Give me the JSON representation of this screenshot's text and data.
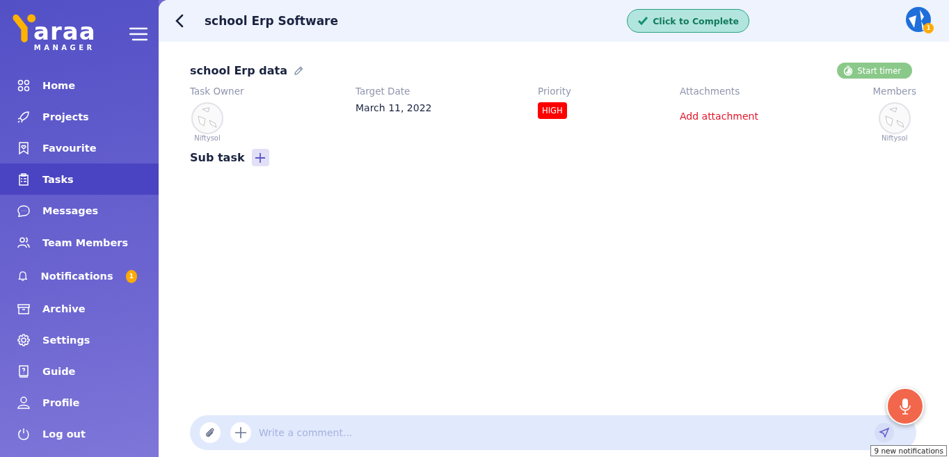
{
  "brand": {
    "name": "araa",
    "tagline": "MANAGER"
  },
  "sidebar": {
    "items": [
      {
        "kind": "home",
        "label": "Home",
        "selected": false
      },
      {
        "kind": "projects",
        "label": "Projects",
        "selected": false
      },
      {
        "kind": "favourite",
        "label": "Favourite",
        "selected": false
      },
      {
        "kind": "tasks",
        "label": "Tasks",
        "selected": true
      },
      {
        "kind": "messages",
        "label": "Messages",
        "selected": false
      },
      {
        "kind": "team",
        "label": "Team Members",
        "selected": false
      },
      {
        "kind": "notifications",
        "label": "Notifications",
        "selected": false,
        "badge": "1"
      },
      {
        "kind": "archive",
        "label": "Archive",
        "selected": false
      },
      {
        "kind": "settings",
        "label": "Settings",
        "selected": false
      },
      {
        "kind": "guide",
        "label": "Guide",
        "selected": false
      },
      {
        "kind": "profile",
        "label": "Profile",
        "selected": false
      },
      {
        "kind": "logout",
        "label": "Log out",
        "selected": false
      }
    ]
  },
  "header": {
    "title": "school Erp Software",
    "complete_button": "Click to Complete",
    "avatar_badge": "1"
  },
  "task": {
    "title": "school Erp data",
    "timer_button": "Start timer",
    "fields": [
      {
        "kind": "owner",
        "label": "Task Owner",
        "name": "Niftysol"
      },
      {
        "kind": "date",
        "label": "Target Date",
        "value": "March 11, 2022"
      },
      {
        "kind": "priority",
        "label": "Priority",
        "value": "HIGH"
      },
      {
        "kind": "attachments",
        "label": "Attachments",
        "value": "Add attachment"
      },
      {
        "kind": "members",
        "label": "Members",
        "name": "Niftysol"
      }
    ],
    "subtask_label": "Sub task"
  },
  "comment": {
    "placeholder": "Write a comment..."
  },
  "tooltip": "9 new notifications"
}
